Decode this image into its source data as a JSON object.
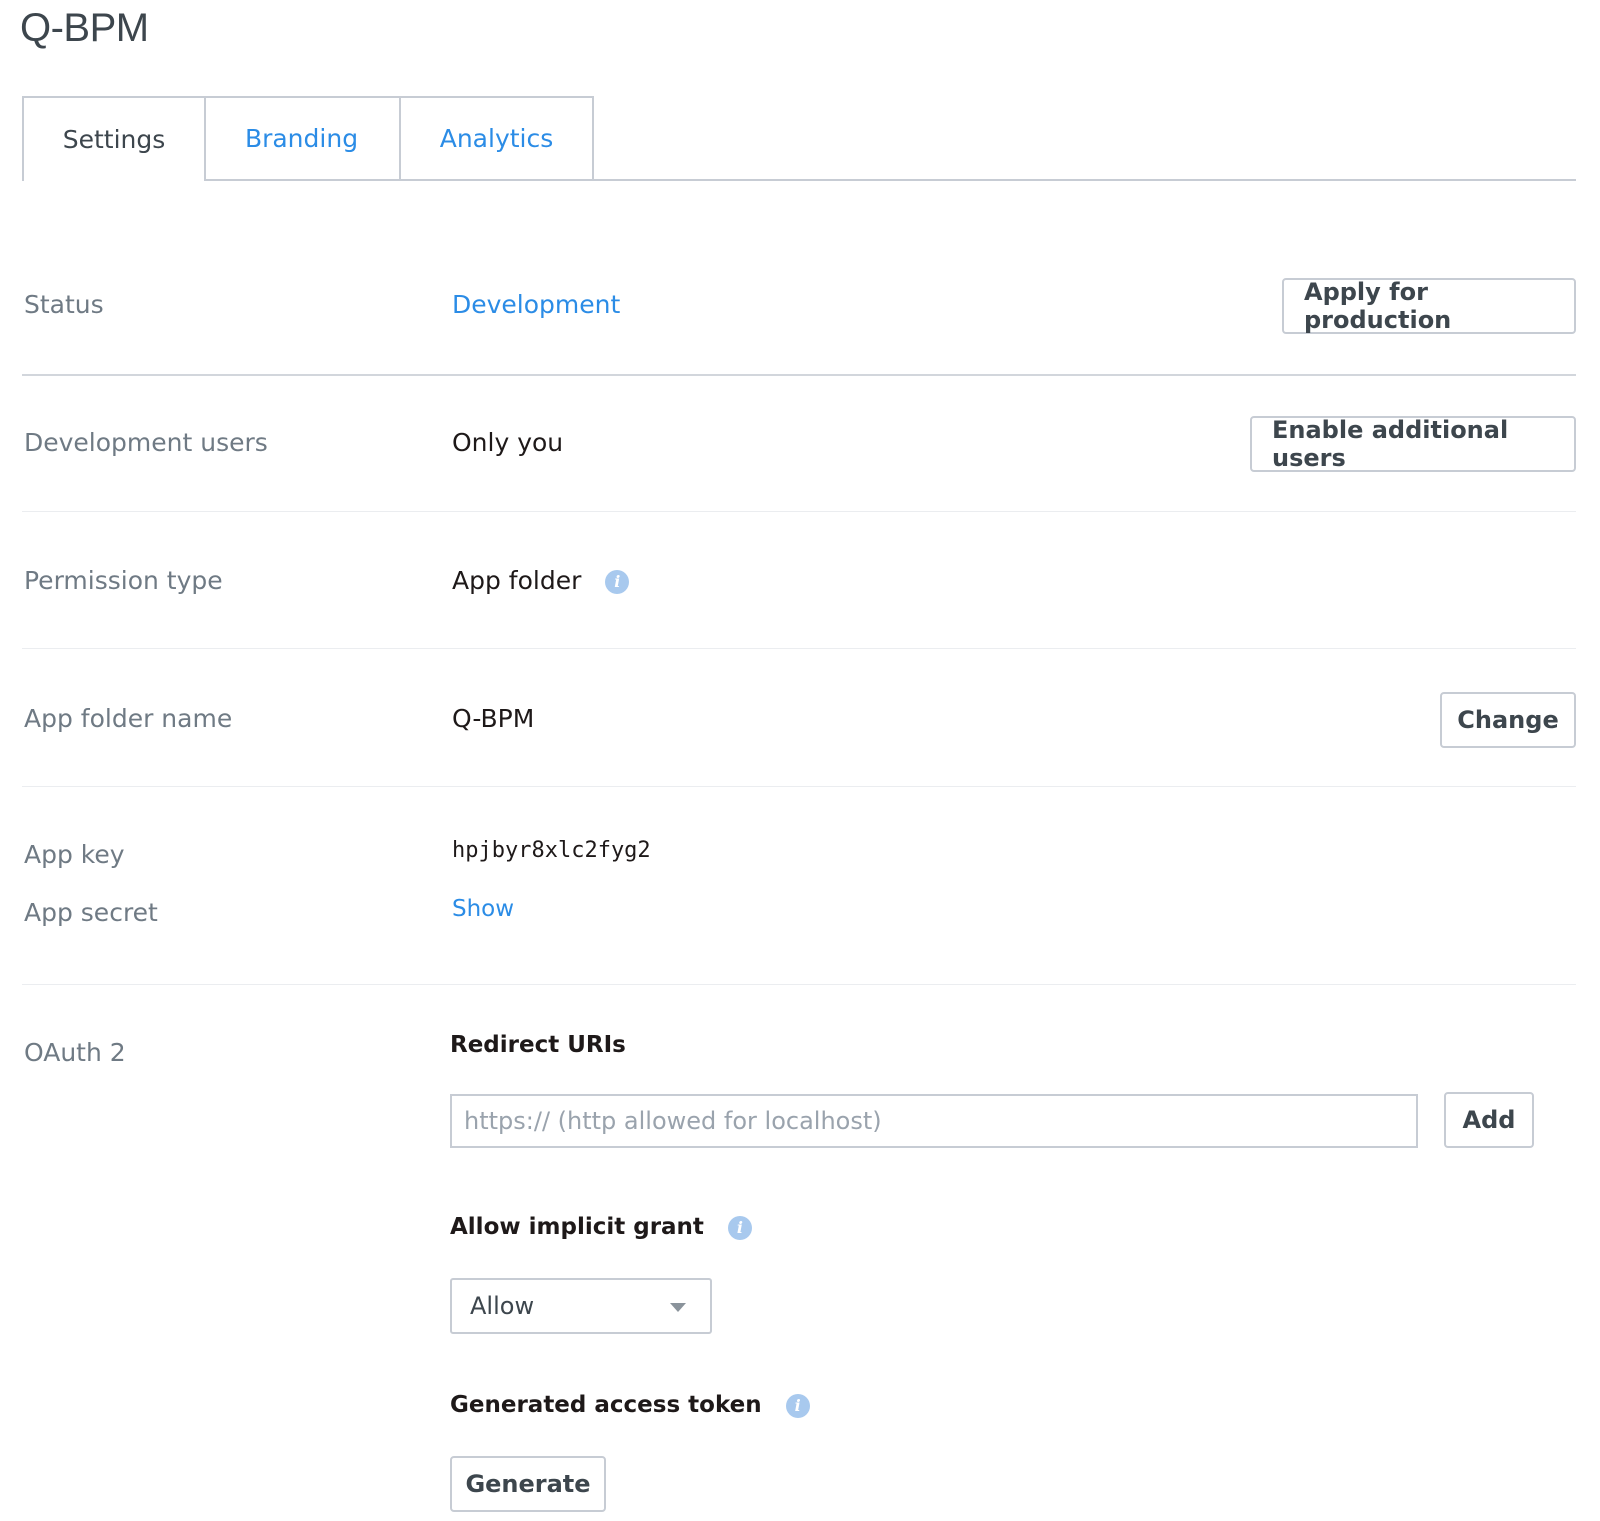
{
  "app": {
    "title": "Q-BPM"
  },
  "tabs": [
    {
      "label": "Settings",
      "active": true
    },
    {
      "label": "Branding",
      "active": false
    },
    {
      "label": "Analytics",
      "active": false
    }
  ],
  "settings": {
    "status": {
      "label": "Status",
      "value": "Development",
      "button": "Apply for production"
    },
    "dev_users": {
      "label": "Development users",
      "value": "Only you",
      "button": "Enable additional users"
    },
    "permission": {
      "label": "Permission type",
      "value": "App folder",
      "icon": "info-icon"
    },
    "folder_name": {
      "label": "App folder name",
      "value": "Q-BPM",
      "button": "Change"
    },
    "app_key": {
      "label": "App key",
      "value": "hpjbyr8xlc2fyg2"
    },
    "app_secret": {
      "label": "App secret",
      "link": "Show"
    },
    "oauth": {
      "label": "OAuth 2",
      "redirect_heading": "Redirect URIs",
      "redirect_placeholder": "https:// (http allowed for localhost)",
      "redirect_value": "",
      "add_button": "Add",
      "implicit_heading": "Allow implicit grant",
      "implicit_selected": "Allow",
      "token_heading": "Generated access token",
      "generate_button": "Generate"
    }
  },
  "colors": {
    "link": "#2b8ce6",
    "label": "#6f7a84",
    "border": "#c7ccd4",
    "info_icon": "#a8c9ee"
  }
}
